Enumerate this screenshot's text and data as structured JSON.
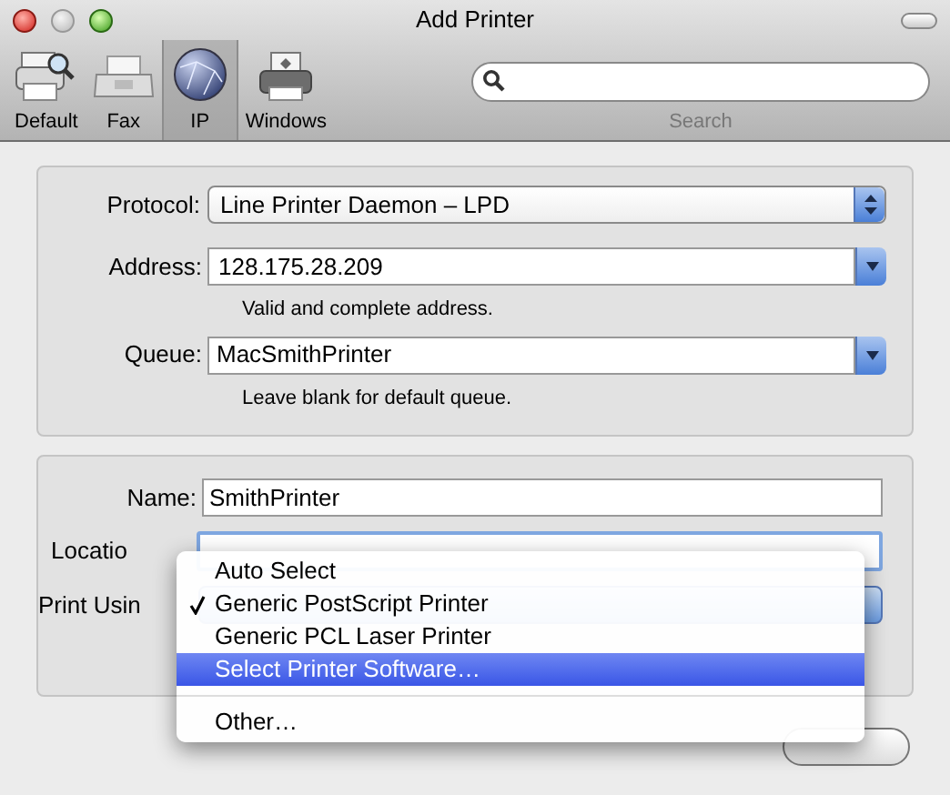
{
  "window": {
    "title": "Add Printer"
  },
  "toolbar": {
    "items": [
      {
        "label": "Default",
        "kind": "default",
        "selected": false
      },
      {
        "label": "Fax",
        "kind": "fax",
        "selected": false
      },
      {
        "label": "IP",
        "kind": "ip",
        "selected": true
      },
      {
        "label": "Windows",
        "kind": "windows",
        "selected": false
      }
    ],
    "search": {
      "label": "Search"
    }
  },
  "connection": {
    "protocol": {
      "label": "Protocol:",
      "value": "Line Printer Daemon – LPD"
    },
    "address": {
      "label": "Address:",
      "value": "128.175.28.209",
      "hint": "Valid and complete address."
    },
    "queue": {
      "label": "Queue:",
      "value": "MacSmithPrinter",
      "hint": "Leave blank for default queue."
    }
  },
  "details": {
    "name": {
      "label": "Name:",
      "value": "SmithPrinter"
    },
    "location": {
      "label": "Locatio"
    },
    "print_using": {
      "label": "Print Usin"
    }
  },
  "menu": {
    "items": [
      {
        "label": "Auto Select",
        "checked": false,
        "selected": false
      },
      {
        "label": "Generic PostScript Printer",
        "checked": true,
        "selected": false
      },
      {
        "label": "Generic PCL Laser Printer",
        "checked": false,
        "selected": false
      },
      {
        "label": "Select Printer Software…",
        "checked": false,
        "selected": true
      },
      {
        "kind": "separator"
      },
      {
        "label": "Other…",
        "checked": false,
        "selected": false
      }
    ]
  }
}
